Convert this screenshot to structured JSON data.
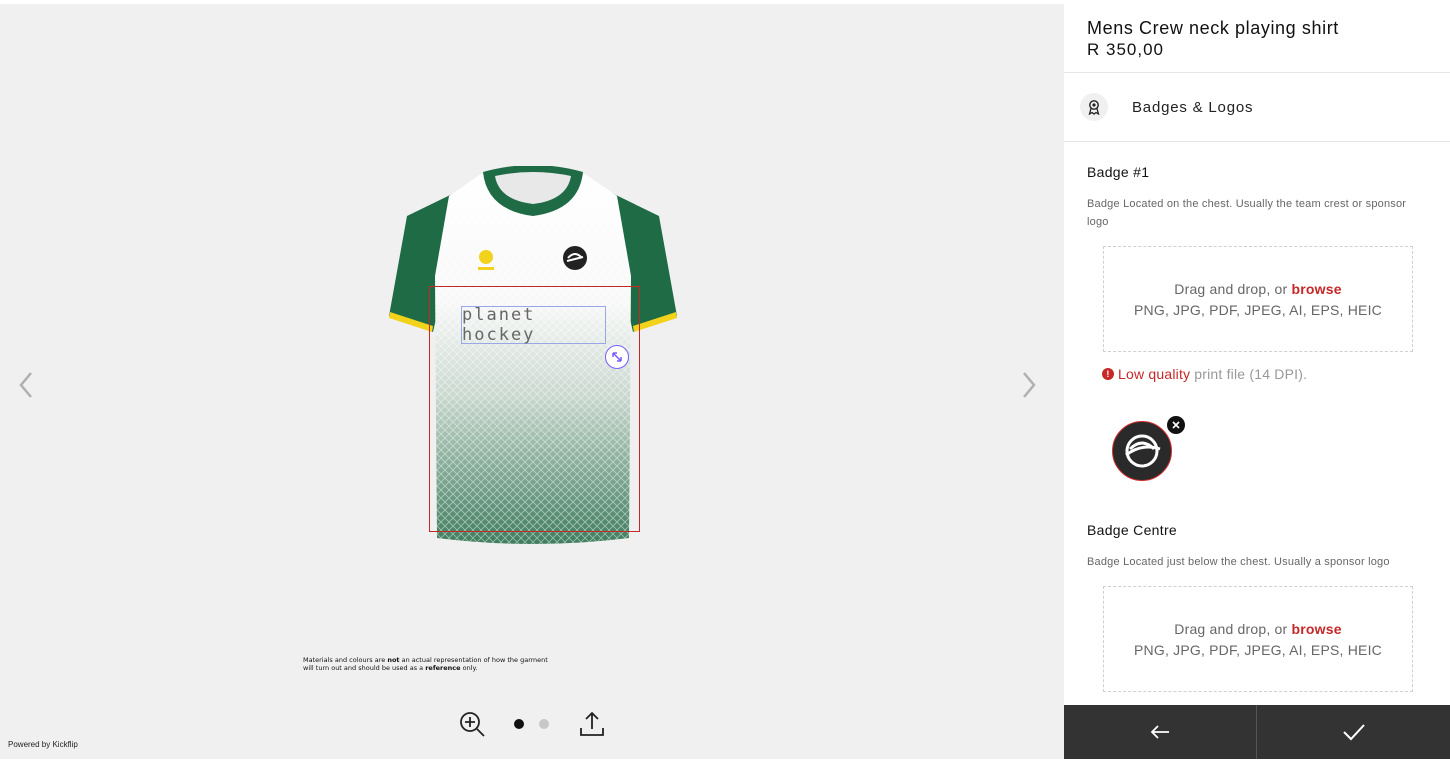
{
  "product": {
    "title": "Mens Crew neck playing shirt",
    "price": "R 350,00"
  },
  "section": {
    "label": "Badges & Logos",
    "icon": "badge-ribbon-icon"
  },
  "badges": [
    {
      "title": "Badge #1",
      "description": "Badge Located on the chest. Usually the team crest or sponsor logo",
      "dropzone": {
        "prefix": "Drag and drop, or ",
        "browse": "browse",
        "formats": "PNG, JPG, PDF, JPEG, AI, EPS, HEIC"
      },
      "warning": {
        "strong": "Low quality",
        "rest": "print file (14 DPI)."
      }
    },
    {
      "title": "Badge Centre",
      "description": "Badge Located just below the chest. Usually a sponsor logo",
      "dropzone": {
        "prefix": "Drag and drop, or ",
        "browse": "browse",
        "formats": "PNG, JPG, PDF, JPEG, AI, EPS, HEIC"
      }
    }
  ],
  "viewer": {
    "shirt_text": "planet hockey",
    "disclaimer": {
      "part1": "Materials and colours are ",
      "bold1": "not",
      "part2": " an actual representation of how the garment will turn out and should be used as a ",
      "bold2": "reference",
      "part3": " only."
    },
    "powered_prefix": "Powered by ",
    "powered_brand": "Kickflip",
    "active_slide": 1,
    "slide_count": 2
  },
  "colors": {
    "accent": "#c62828",
    "footer": "#333333",
    "shirt_green": "#1e6b45",
    "shirt_yellow": "#f2d21a"
  }
}
